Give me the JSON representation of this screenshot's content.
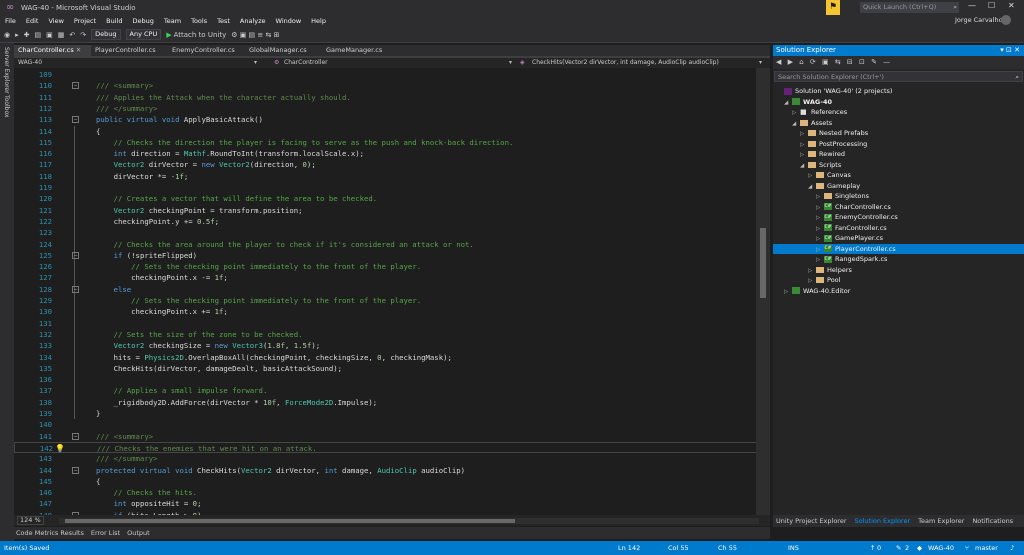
{
  "window": {
    "title": "WAG-40 - Microsoft Visual Studio",
    "quick_launch": "Quick Launch (Ctrl+Q)",
    "user": "Jorge Carvalho"
  },
  "menu": [
    "File",
    "Edit",
    "View",
    "Project",
    "Build",
    "Debug",
    "Team",
    "Tools",
    "Test",
    "Analyze",
    "Window",
    "Help"
  ],
  "toolbar": {
    "config": "Debug",
    "platform": "Any CPU",
    "attach": "Attach to Unity"
  },
  "left_strip": [
    "Server Explorer",
    "Toolbox"
  ],
  "tabs": [
    {
      "label": "CharController.cs",
      "active": true
    },
    {
      "label": "PlayerController.cs",
      "active": false
    },
    {
      "label": "EnemyController.cs",
      "active": false
    },
    {
      "label": "GlobalManager.cs",
      "active": false
    },
    {
      "label": "GameManager.cs",
      "active": false
    }
  ],
  "navbar": {
    "project": "WAG-40",
    "class": "CharController",
    "member": "CheckHits(Vector2 dirVector, int damage, AudioClip audioClip)"
  },
  "code_lines": [
    {
      "n": "109",
      "t": []
    },
    {
      "n": "110",
      "t": [
        [
          "xd",
          "/// <summary>"
        ]
      ]
    },
    {
      "n": "111",
      "t": [
        [
          "xd",
          "/// Applies the Attack when the character actually should."
        ]
      ]
    },
    {
      "n": "112",
      "t": [
        [
          "xd",
          "/// </summary>"
        ]
      ]
    },
    {
      "n": "113",
      "t": [
        [
          "kw",
          "public virtual void "
        ],
        [
          "pl",
          "ApplyBasicAttack()"
        ]
      ]
    },
    {
      "n": "114",
      "t": [
        [
          "pl",
          "{"
        ]
      ]
    },
    {
      "n": "115",
      "t": [
        [
          "pl",
          "    "
        ],
        [
          "cm",
          "// Checks the direction the player is facing to serve as the push and knock-back direction."
        ]
      ]
    },
    {
      "n": "116",
      "t": [
        [
          "pl",
          "    "
        ],
        [
          "kw",
          "int "
        ],
        [
          "pl",
          "direction = "
        ],
        [
          "ty",
          "Mathf"
        ],
        [
          "pl",
          ".RoundToInt(transform.localScale.x);"
        ]
      ]
    },
    {
      "n": "117",
      "t": [
        [
          "pl",
          "    "
        ],
        [
          "ty",
          "Vector2 "
        ],
        [
          "pl",
          "dirVector = "
        ],
        [
          "kw",
          "new "
        ],
        [
          "ty",
          "Vector2"
        ],
        [
          "pl",
          "(direction, "
        ],
        [
          "nu",
          "0"
        ],
        [
          "pl",
          ");"
        ]
      ]
    },
    {
      "n": "118",
      "t": [
        [
          "pl",
          "    dirVector *= "
        ],
        [
          "nu",
          "-1f"
        ],
        [
          "pl",
          ";"
        ]
      ]
    },
    {
      "n": "119",
      "t": []
    },
    {
      "n": "120",
      "t": [
        [
          "pl",
          "    "
        ],
        [
          "cm",
          "// Creates a vector that will define the area to be checked."
        ]
      ]
    },
    {
      "n": "121",
      "t": [
        [
          "pl",
          "    "
        ],
        [
          "ty",
          "Vector2 "
        ],
        [
          "pl",
          "checkingPoint = transform.position;"
        ]
      ]
    },
    {
      "n": "122",
      "t": [
        [
          "pl",
          "    checkingPoint.y += "
        ],
        [
          "nu",
          "0.5f"
        ],
        [
          "pl",
          ";"
        ]
      ]
    },
    {
      "n": "123",
      "t": []
    },
    {
      "n": "124",
      "t": [
        [
          "pl",
          "    "
        ],
        [
          "cm",
          "// Checks the area around the player to check if it's considered an attack or not."
        ]
      ]
    },
    {
      "n": "125",
      "t": [
        [
          "pl",
          "    "
        ],
        [
          "kw",
          "if "
        ],
        [
          "pl",
          "(!spriteFlipped)"
        ]
      ]
    },
    {
      "n": "126",
      "t": [
        [
          "pl",
          "        "
        ],
        [
          "cm",
          "// Sets the checking point immediately to the front of the player."
        ]
      ]
    },
    {
      "n": "127",
      "t": [
        [
          "pl",
          "        checkingPoint.x -= "
        ],
        [
          "nu",
          "1f"
        ],
        [
          "pl",
          ";"
        ]
      ]
    },
    {
      "n": "128",
      "t": [
        [
          "pl",
          "    "
        ],
        [
          "kw",
          "else"
        ]
      ]
    },
    {
      "n": "129",
      "t": [
        [
          "pl",
          "        "
        ],
        [
          "cm",
          "// Sets the checking point immediately to the front of the player."
        ]
      ]
    },
    {
      "n": "130",
      "t": [
        [
          "pl",
          "        checkingPoint.x += "
        ],
        [
          "nu",
          "1f"
        ],
        [
          "pl",
          ";"
        ]
      ]
    },
    {
      "n": "131",
      "t": []
    },
    {
      "n": "132",
      "t": [
        [
          "pl",
          "    "
        ],
        [
          "cm",
          "// Sets the size of the zone to be checked."
        ]
      ]
    },
    {
      "n": "133",
      "t": [
        [
          "pl",
          "    "
        ],
        [
          "ty",
          "Vector2 "
        ],
        [
          "pl",
          "checkingSize = "
        ],
        [
          "kw",
          "new "
        ],
        [
          "ty",
          "Vector3"
        ],
        [
          "pl",
          "("
        ],
        [
          "nu",
          "1.8f"
        ],
        [
          "pl",
          ", "
        ],
        [
          "nu",
          "1.5f"
        ],
        [
          "pl",
          ");"
        ]
      ]
    },
    {
      "n": "134",
      "t": [
        [
          "pl",
          "    hits = "
        ],
        [
          "ty",
          "Physics2D"
        ],
        [
          "pl",
          ".OverlapBoxAll(checkingPoint, checkingSize, "
        ],
        [
          "nu",
          "0"
        ],
        [
          "pl",
          ", checkingMask);"
        ]
      ]
    },
    {
      "n": "135",
      "t": [
        [
          "pl",
          "    CheckHits(dirVector, damageDealt, basicAttackSound);"
        ]
      ]
    },
    {
      "n": "136",
      "t": []
    },
    {
      "n": "137",
      "t": [
        [
          "pl",
          "    "
        ],
        [
          "cm",
          "// Applies a small impulse forward."
        ]
      ]
    },
    {
      "n": "138",
      "t": [
        [
          "pl",
          "    _rigidbody2D.AddForce(dirVector * "
        ],
        [
          "nu",
          "10f"
        ],
        [
          "pl",
          ", "
        ],
        [
          "ty",
          "ForceMode2D"
        ],
        [
          "pl",
          ".Impulse);"
        ]
      ]
    },
    {
      "n": "139",
      "t": [
        [
          "pl",
          "}"
        ]
      ]
    },
    {
      "n": "140",
      "t": []
    },
    {
      "n": "141",
      "t": [
        [
          "xd",
          "/// <summary>"
        ]
      ]
    },
    {
      "n": "142",
      "t": [
        [
          "xd",
          "/// Checks the enemies that were hit on an attack."
        ]
      ]
    },
    {
      "n": "143",
      "t": [
        [
          "xd",
          "/// </summary>"
        ]
      ]
    },
    {
      "n": "144",
      "t": [
        [
          "kw",
          "protected virtual void "
        ],
        [
          "pl",
          "CheckHits("
        ],
        [
          "ty",
          "Vector2 "
        ],
        [
          "pl",
          "dirVector, "
        ],
        [
          "kw",
          "int "
        ],
        [
          "pl",
          "damage, "
        ],
        [
          "ty",
          "AudioClip "
        ],
        [
          "pl",
          "audioClip)"
        ]
      ]
    },
    {
      "n": "145",
      "t": [
        [
          "pl",
          "{"
        ]
      ]
    },
    {
      "n": "146",
      "t": [
        [
          "pl",
          "    "
        ],
        [
          "cm",
          "// Checks the hits."
        ]
      ]
    },
    {
      "n": "147",
      "t": [
        [
          "pl",
          "    "
        ],
        [
          "kw",
          "int "
        ],
        [
          "pl",
          "oppositeHit = "
        ],
        [
          "nu",
          "0"
        ],
        [
          "pl",
          ";"
        ]
      ]
    },
    {
      "n": "148",
      "t": [
        [
          "pl",
          "    "
        ],
        [
          "kw",
          "if "
        ],
        [
          "pl",
          "(hits.Length > "
        ],
        [
          "nu",
          "0"
        ],
        [
          "pl",
          ")"
        ]
      ]
    }
  ],
  "current_line_index": 33,
  "zoom": "124 %",
  "bottom_tabs": [
    "Code Metrics Results",
    "Error List",
    "Output"
  ],
  "solution_explorer": {
    "title": "Solution Explorer",
    "search_placeholder": "Search Solution Explorer (Ctrl+')",
    "items": [
      {
        "label": "Solution 'WAG-40' (2 projects)",
        "icon": "sol",
        "indent": 0,
        "arrow": ""
      },
      {
        "label": "WAG-40",
        "icon": "prj",
        "indent": 1,
        "arrow": "◢",
        "bold": true
      },
      {
        "label": "References",
        "icon": "ref",
        "indent": 2,
        "arrow": "▷"
      },
      {
        "label": "Assets",
        "icon": "fld",
        "indent": 2,
        "arrow": "◢"
      },
      {
        "label": "Nested Prefabs",
        "icon": "fld",
        "indent": 3,
        "arrow": "▷"
      },
      {
        "label": "PostProcessing",
        "icon": "fld",
        "indent": 3,
        "arrow": "▷"
      },
      {
        "label": "Rewired",
        "icon": "fld",
        "indent": 3,
        "arrow": "▷"
      },
      {
        "label": "Scripts",
        "icon": "fld",
        "indent": 3,
        "arrow": "◢"
      },
      {
        "label": "Canvas",
        "icon": "fld",
        "indent": 4,
        "arrow": "▷"
      },
      {
        "label": "Gameplay",
        "icon": "fld",
        "indent": 4,
        "arrow": "◢"
      },
      {
        "label": "Singletons",
        "icon": "fld",
        "indent": 5,
        "arrow": "▷"
      },
      {
        "label": "CharController.cs",
        "icon": "cs",
        "indent": 5,
        "arrow": "▷"
      },
      {
        "label": "EnemyController.cs",
        "icon": "cs",
        "indent": 5,
        "arrow": "▷"
      },
      {
        "label": "FanController.cs",
        "icon": "cs",
        "indent": 5,
        "arrow": "▷"
      },
      {
        "label": "GamePlayer.cs",
        "icon": "cs",
        "indent": 5,
        "arrow": "▷"
      },
      {
        "label": "PlayerController.cs",
        "icon": "cs",
        "indent": 5,
        "arrow": "▷",
        "selected": true
      },
      {
        "label": "RangedSpark.cs",
        "icon": "cs",
        "indent": 5,
        "arrow": "▷"
      },
      {
        "label": "Helpers",
        "icon": "fld",
        "indent": 4,
        "arrow": "▷"
      },
      {
        "label": "Pool",
        "icon": "fld",
        "indent": 4,
        "arrow": "▷"
      },
      {
        "label": "WAG-40.Editor",
        "icon": "prj",
        "indent": 1,
        "arrow": "▷"
      }
    ],
    "tabs": [
      {
        "label": "Unity Project Explorer",
        "active": false
      },
      {
        "label": "Solution Explorer",
        "active": true
      },
      {
        "label": "Team Explorer",
        "active": false
      },
      {
        "label": "Notifications",
        "active": false
      }
    ]
  },
  "status": {
    "left": "Item(s) Saved",
    "ln": "Ln 142",
    "col": "Col 55",
    "ch": "Ch 55",
    "ins": "INS",
    "up": "0",
    "pencil": "2",
    "project": "WAG-40",
    "branch": "master"
  },
  "colors": {
    "accent": "#007acc",
    "keyword": "#569cd6",
    "type": "#4ec9b0",
    "comment": "#57a64a",
    "number": "#b5cea8"
  }
}
